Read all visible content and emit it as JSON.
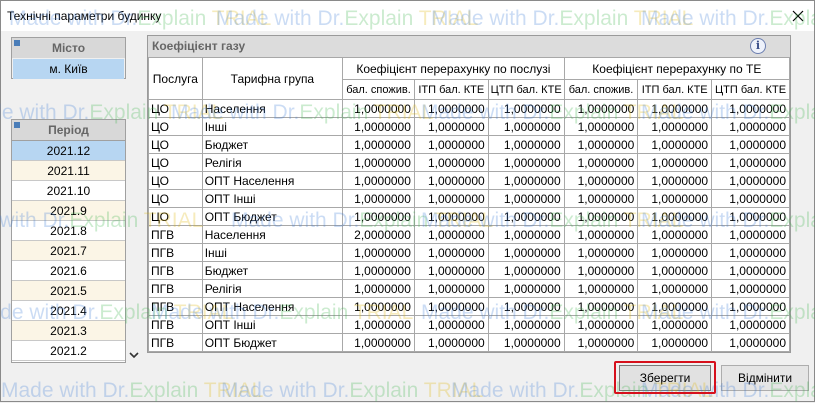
{
  "window": {
    "title": "Технічні параметри будинку"
  },
  "city": {
    "header": "Місто",
    "value": "м. Київ"
  },
  "period": {
    "header": "Період",
    "items": [
      "2021.12",
      "2021.11",
      "2021.10",
      "2021.9",
      "2021.8",
      "2021.7",
      "2021.6",
      "2021.5",
      "2021.4",
      "2021.3",
      "2021.2"
    ],
    "selected_index": 0
  },
  "grid": {
    "caption": "Коефіцієнт газу",
    "col_service": "Послуга",
    "col_tariff": "Тарифна група",
    "group_service": "Коефіцієнт перерахунку по послузі",
    "group_te": "Коефіцієнт перерахунку по ТЕ",
    "subcols": [
      "бал. спожив.",
      "ІТП бал. КТЕ",
      "ЦТП бал. КТЕ",
      "бал. спожив.",
      "ІТП бал. КТЕ",
      "ЦТП бал. КТЕ"
    ],
    "rows": [
      {
        "service": "ЦО",
        "tariff": "Населення",
        "values": [
          "1,0000000",
          "1,0000000",
          "1,0000000",
          "1,0000000",
          "1,0000000",
          "1,0000000"
        ]
      },
      {
        "service": "ЦО",
        "tariff": "Інші",
        "values": [
          "1,0000000",
          "1,0000000",
          "1,0000000",
          "1,0000000",
          "1,0000000",
          "1,0000000"
        ]
      },
      {
        "service": "ЦО",
        "tariff": "Бюджет",
        "values": [
          "1,0000000",
          "1,0000000",
          "1,0000000",
          "1,0000000",
          "1,0000000",
          "1,0000000"
        ]
      },
      {
        "service": "ЦО",
        "tariff": "Релігія",
        "values": [
          "1,0000000",
          "1,0000000",
          "1,0000000",
          "1,0000000",
          "1,0000000",
          "1,0000000"
        ]
      },
      {
        "service": "ЦО",
        "tariff": "ОПТ Населення",
        "values": [
          "1,0000000",
          "1,0000000",
          "1,0000000",
          "1,0000000",
          "1,0000000",
          "1,0000000"
        ]
      },
      {
        "service": "ЦО",
        "tariff": "ОПТ Інші",
        "values": [
          "1,0000000",
          "1,0000000",
          "1,0000000",
          "1,0000000",
          "1,0000000",
          "1,0000000"
        ]
      },
      {
        "service": "ЦО",
        "tariff": "ОПТ Бюджет",
        "values": [
          "1,0000000",
          "1,0000000",
          "1,0000000",
          "1,0000000",
          "1,0000000",
          "1,0000000"
        ]
      },
      {
        "service": "ПГВ",
        "tariff": "Населення",
        "values": [
          "2,0000000",
          "1,0000000",
          "1,0000000",
          "1,0000000",
          "1,0000000",
          "1,0000000"
        ]
      },
      {
        "service": "ПГВ",
        "tariff": "Інші",
        "values": [
          "1,0000000",
          "1,0000000",
          "1,0000000",
          "1,0000000",
          "1,0000000",
          "1,0000000"
        ]
      },
      {
        "service": "ПГВ",
        "tariff": "Бюджет",
        "values": [
          "1,0000000",
          "1,0000000",
          "1,0000000",
          "1,0000000",
          "1,0000000",
          "1,0000000"
        ]
      },
      {
        "service": "ПГВ",
        "tariff": "Релігія",
        "values": [
          "1,0000000",
          "1,0000000",
          "1,0000000",
          "1,0000000",
          "1,0000000",
          "1,0000000"
        ]
      },
      {
        "service": "ПГВ",
        "tariff": "ОПТ Населення",
        "values": [
          "1,0000000",
          "1,0000000",
          "1,0000000",
          "1,0000000",
          "1,0000000",
          "1,0000000"
        ]
      },
      {
        "service": "ПГВ",
        "tariff": "ОПТ Інші",
        "values": [
          "1,0000000",
          "1,0000000",
          "1,0000000",
          "1,0000000",
          "1,0000000",
          "1,0000000"
        ]
      },
      {
        "service": "ПГВ",
        "tariff": "ОПТ Бюджет",
        "values": [
          "1,0000000",
          "1,0000000",
          "1,0000000",
          "1,0000000",
          "1,0000000",
          "1,0000000"
        ]
      }
    ]
  },
  "buttons": {
    "save": "Зберегти",
    "cancel": "Відмінити"
  },
  "watermark": {
    "part1": "Made with Dr.",
    "part2": "Explain",
    "part3": "TRIAL"
  },
  "icons": {
    "close": "close-icon",
    "info": "info-icon",
    "scroll": "chevron-down-icon"
  },
  "colors": {
    "selection": "#b7d6f2",
    "highlight_border": "#d6101c",
    "period_alt_row": "#fbf5e6"
  }
}
